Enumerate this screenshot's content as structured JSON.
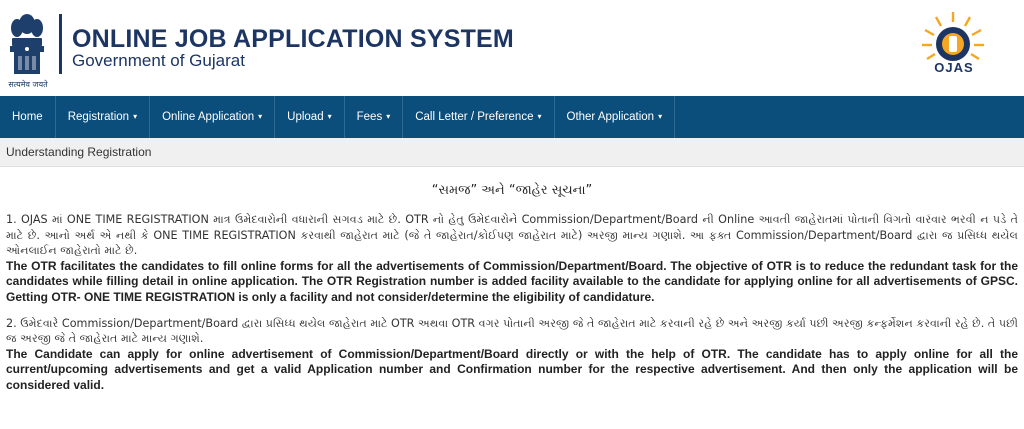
{
  "header": {
    "title": "ONLINE JOB APPLICATION SYSTEM",
    "subtitle": "Government of Gujarat",
    "emblem_caption": "सत्यमेव जयते",
    "logo_text": "OJAS"
  },
  "nav": {
    "items": [
      {
        "label": "Home",
        "has_caret": false
      },
      {
        "label": "Registration",
        "has_caret": true
      },
      {
        "label": "Online Application",
        "has_caret": true
      },
      {
        "label": "Upload",
        "has_caret": true
      },
      {
        "label": "Fees",
        "has_caret": true
      },
      {
        "label": "Call Letter / Preference",
        "has_caret": true
      },
      {
        "label": "Other Application",
        "has_caret": true
      }
    ],
    "caret": "▾"
  },
  "breadcrumb": "Understanding Registration",
  "notice": {
    "title": "“સમજ” અને “જાહેર સૂચના”",
    "p1_gu": "1. OJAS માં ONE TIME REGISTRATION માત્ર ઉમેદવારોની વધારાની સગવડ માટે છે. OTR નો હેતુ ઉમેદવારોને Commission/Department/Board ની Online આવતી જાહેરાતમાં પોતાની વિગતો વારંવાર ભરવી ન પડે તે માટે છે. આનો અર્થ એ નથી કે ONE TIME REGISTRATION કરવાથી જાહેરાત માટે (જે તે જાહેરાત/કોઈપણ જાહેરાત માટે) અરજી માન્ય ગણાશે. આ ફક્ત Commission/Department/Board દ્વારા જ પ્રસિધ્ધ થયેલ ઓનલાઈન જાહેરાતો માટે છે.",
    "p1_en": "The OTR facilitates the candidates to fill online forms for all the advertisements of Commission/Department/Board. The objective of OTR is to reduce the redundant task for the candidates while filling detail in online application. The OTR Registration number is added facility available to the candidate for applying online for all advertisements of GPSC. Getting OTR- ONE TIME REGISTRATION is only a facility and not consider/determine the eligibility of candidature.",
    "p2_gu": "2. ઉમેદવારે Commission/Department/Board દ્વારા પ્રસિધ્ધ થયેલ જાહેરાત માટે OTR અથવા OTR વગર પોતાની અરજી જે તે જાહેરાત માટે કરવાની રહે છે અને અરજી કર્યા પછી અરજી કન્ફર્મેશન કરવાની રહે છે. તે પછી જ અરજી જે તે જાહેરાત માટે માન્ય ગણાશે.",
    "p2_en": "The Candidate can apply for online advertisement of Commission/Department/Board directly or with the help of OTR. The candidate has to apply online for all the current/upcoming advertisements and get a valid Application number and Confirmation number for the respective advertisement. And then only the application will be considered valid."
  },
  "colors": {
    "nav_bg": "#0b4d7b",
    "title_color": "#1d3563",
    "crumb_bg": "#f0f0f0",
    "logo_orange": "#f5a623"
  }
}
